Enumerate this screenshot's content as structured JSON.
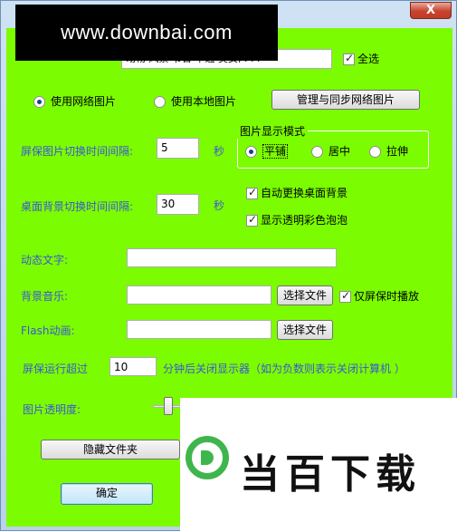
{
  "window": {
    "close_label": "X"
  },
  "watermark": {
    "text": "www.downbai.com"
  },
  "image_source": {
    "combo_value": "动物  风景  节日  卡通  美女,  . . .",
    "select_all": {
      "label": "全选",
      "checked": true
    },
    "use_network": {
      "label": "使用网络图片",
      "selected": true
    },
    "use_local": {
      "label": "使用本地图片",
      "selected": false
    },
    "manage_button": "管理与同步网络图片"
  },
  "screensaver": {
    "interval_label": "屏保图片切换时间间隔:",
    "interval_value": "5",
    "interval_unit": "秒"
  },
  "display_mode": {
    "title": "图片显示模式",
    "options": [
      {
        "label": "平铺",
        "selected": true
      },
      {
        "label": "居中",
        "selected": false
      },
      {
        "label": "拉伸",
        "selected": false
      }
    ]
  },
  "wallpaper": {
    "interval_label": "桌面背景切换时间间隔:",
    "interval_value": "30",
    "interval_unit": "秒",
    "auto_change": {
      "label": "自动更换桌面背景",
      "checked": true
    },
    "show_bubbles": {
      "label": "显示透明彩色泡泡",
      "checked": true
    }
  },
  "dynamic_text": {
    "label": "动态文字:",
    "value": ""
  },
  "music": {
    "label": "背景音乐:",
    "value": "",
    "choose_button": "选择文件",
    "only_screensaver": {
      "label": "仅屏保时播放",
      "checked": true
    }
  },
  "flash": {
    "label": "Flash动画:",
    "value": "",
    "choose_button": "选择文件"
  },
  "monitor": {
    "prefix": "屏保运行超过",
    "value": "10",
    "suffix": "分钟后关闭显示器（如为负数则表示关闭计算机 ）"
  },
  "transparency": {
    "label": "图片透明度:",
    "level": 0.1
  },
  "hide_folder_button": "隐藏文件夹",
  "ok_button": "确定",
  "brand": {
    "text": "当百下载"
  },
  "colors": {
    "client_bg": "#7cfc00",
    "label_blue": "#3a57d6",
    "brand_green": "#3fb64d"
  }
}
